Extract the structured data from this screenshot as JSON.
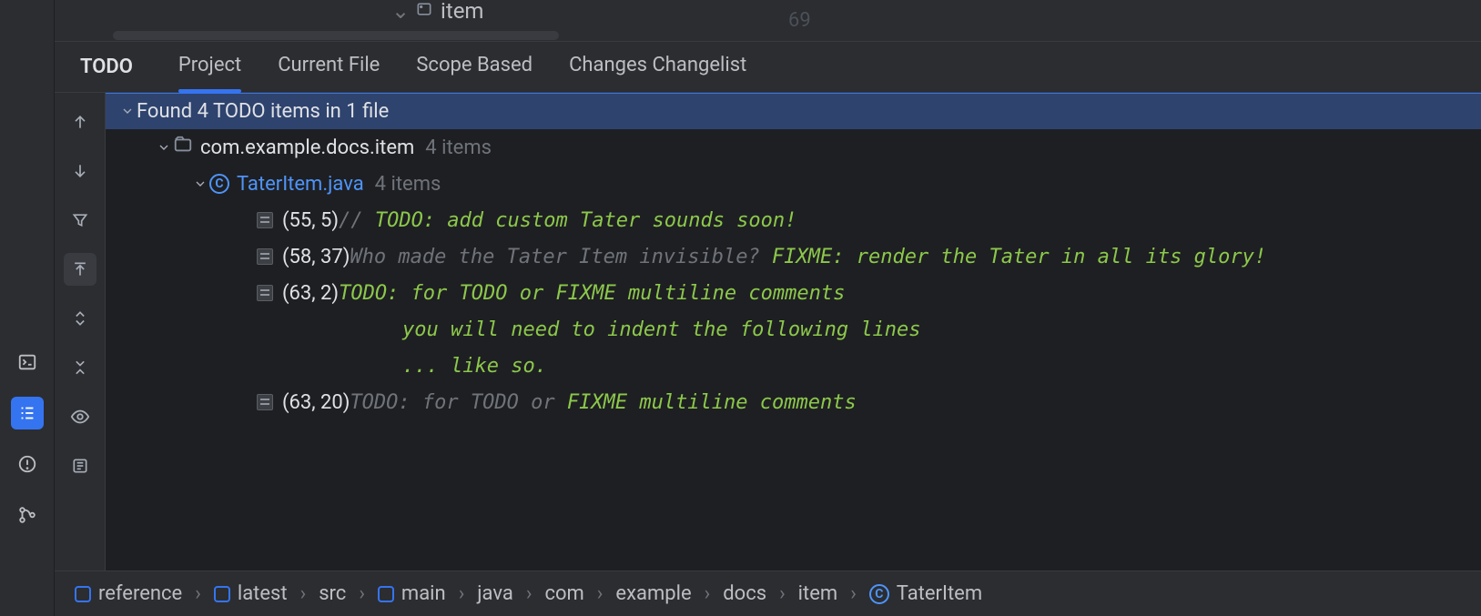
{
  "editor": {
    "tab_chevron": "⌄",
    "tab_file_label": "item",
    "visible_line_number": "69"
  },
  "todo_panel": {
    "title": "TODO",
    "tabs": [
      {
        "label": "Project",
        "active": true
      },
      {
        "label": "Current File",
        "active": false
      },
      {
        "label": "Scope Based",
        "active": false
      },
      {
        "label": "Changes Changelist",
        "active": false
      }
    ],
    "root_summary": "Found 4 TODO items in 1 file",
    "package": {
      "name": "com.example.docs.item",
      "count_label": "4 items"
    },
    "file": {
      "name": "TaterItem.java",
      "count_label": "4 items"
    },
    "items": [
      {
        "coord": "(55, 5)",
        "segments": [
          {
            "text": "// ",
            "cls": "c-gray"
          },
          {
            "text": "TODO: add custom Tater sounds soon!",
            "cls": "c-green"
          }
        ]
      },
      {
        "coord": "(58, 37)",
        "segments": [
          {
            "text": "Who made the Tater Item invisible? ",
            "cls": "c-gray"
          },
          {
            "text": "FIXME: render the Tater in all its glory!",
            "cls": "c-green"
          }
        ]
      },
      {
        "coord": "(63, 2)",
        "segments": [
          {
            "text": "   TODO: for TODO or FIXME multiline comments",
            "cls": "c-green"
          }
        ],
        "continuation": [
          "you will need to indent the following lines",
          "... like so."
        ]
      },
      {
        "coord": "(63, 20)",
        "segments": [
          {
            "text": "TODO: for TODO or ",
            "cls": "c-gray"
          },
          {
            "text": "FIXME multiline comments",
            "cls": "c-green"
          }
        ]
      }
    ]
  },
  "breadcrumb": [
    {
      "label": "reference",
      "kind": "module"
    },
    {
      "label": "latest",
      "kind": "module"
    },
    {
      "label": "src",
      "kind": "plain"
    },
    {
      "label": "main",
      "kind": "module"
    },
    {
      "label": "java",
      "kind": "plain"
    },
    {
      "label": "com",
      "kind": "plain"
    },
    {
      "label": "example",
      "kind": "plain"
    },
    {
      "label": "docs",
      "kind": "plain"
    },
    {
      "label": "item",
      "kind": "plain"
    },
    {
      "label": "TaterItem",
      "kind": "class"
    }
  ]
}
